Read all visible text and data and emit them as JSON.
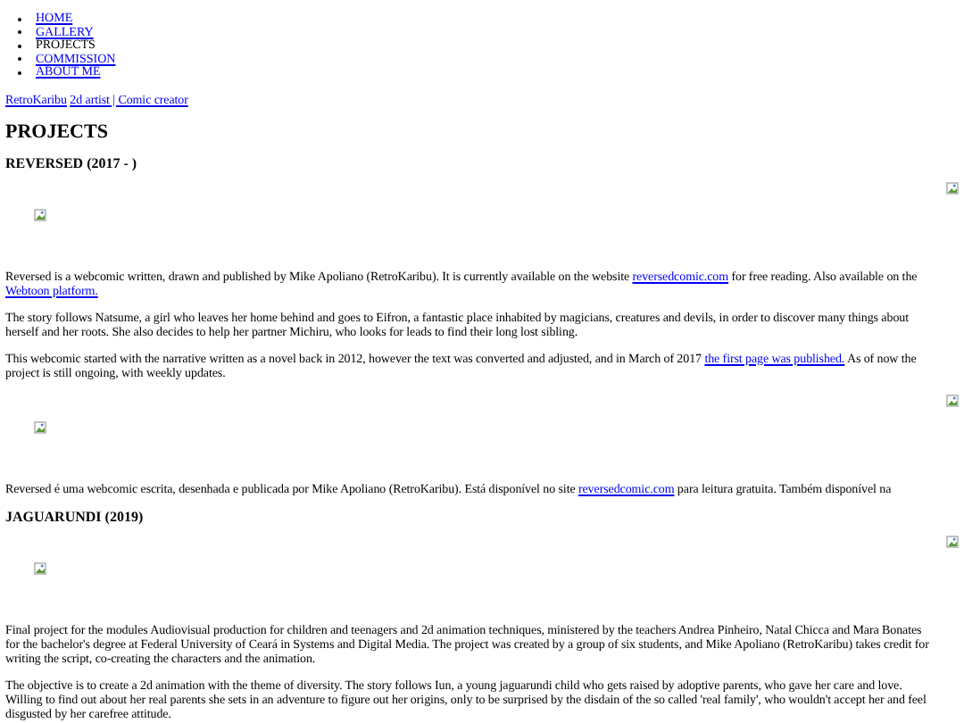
{
  "nav": [
    {
      "label": "HOME",
      "selected": false
    },
    {
      "label": "GALLERY",
      "selected": false
    },
    {
      "label": "PROJECTS",
      "selected": true
    },
    {
      "label": "COMMISSION",
      "selected": false
    },
    {
      "label": "ABOUT ME",
      "selected": false
    }
  ],
  "brand": {
    "name": "RetroKaribu",
    "tagline": "2d artist | Comic creator"
  },
  "page_title": "PROJECTS",
  "projects": [
    {
      "title": "REVERSED (2017 - )",
      "paragraphs": [
        [
          {
            "kind": "text",
            "text": "Reversed is a webcomic written, drawn and published by Mike Apoliano (RetroKaribu). It is currently available on the website "
          },
          {
            "kind": "link",
            "text": "reversedcomic.com"
          },
          {
            "kind": "text",
            "text": " for free reading. Also available on the "
          },
          {
            "kind": "link",
            "text": "Webtoon platform."
          }
        ],
        [
          {
            "kind": "text",
            "text": "The story follows Natsume, a girl who leaves her home behind and goes to Eifron, a fantastic place inhabited by magicians, creatures and devils, in order to discover many things about herself and her roots. She also decides to help her partner Michiru, who looks for leads to find their long lost sibling."
          }
        ],
        [
          {
            "kind": "text",
            "text": "This webcomic started with the narrative written as a novel back in 2012, however the text was converted and adjusted, and in March of 2017 "
          },
          {
            "kind": "link",
            "text": "the first page was published."
          },
          {
            "kind": "text",
            "text": " As of now the project is still ongoing, with weekly updates."
          }
        ],
        [
          {
            "kind": "image"
          }
        ],
        [
          {
            "kind": "text",
            "text": "Reversed é uma webcomic escrita, desenhada e publicada por Mike Apoliano (RetroKaribu). Está disponível no site "
          },
          {
            "kind": "link",
            "text": "reversedcomic.com"
          },
          {
            "kind": "text",
            "text": " para leitura gratuita. Também disponível na"
          }
        ]
      ]
    },
    {
      "title": "JAGUARUNDI (2019)",
      "paragraphs": [
        [
          {
            "kind": "text",
            "text": "Final project for the modules Audiovisual production for children and teenagers and 2d animation techniques, ministered by the teachers Andrea Pinheiro, Natal Chicca and Mara Bonates for the bachelor's degree at Federal University of Ceará in Systems and Digital Media. The project was created by a group of six students, and Mike Apoliano (RetroKaribu) takes credit for writing the script, co-creating the characters and the animation."
          }
        ],
        [
          {
            "kind": "text",
            "text": "The objective is to create a 2d animation with the theme of diversity. The story follows Iun, a young jaguarundi child who gets raised by adoptive parents, who gave her care and love. Willing to find out about her real parents she sets in an adventure to figure out her origins, only to be surprised by the disdain of the so called 'real family', who wouldn't accept her and feel disgusted by her carefree attitude."
          }
        ]
      ]
    }
  ]
}
